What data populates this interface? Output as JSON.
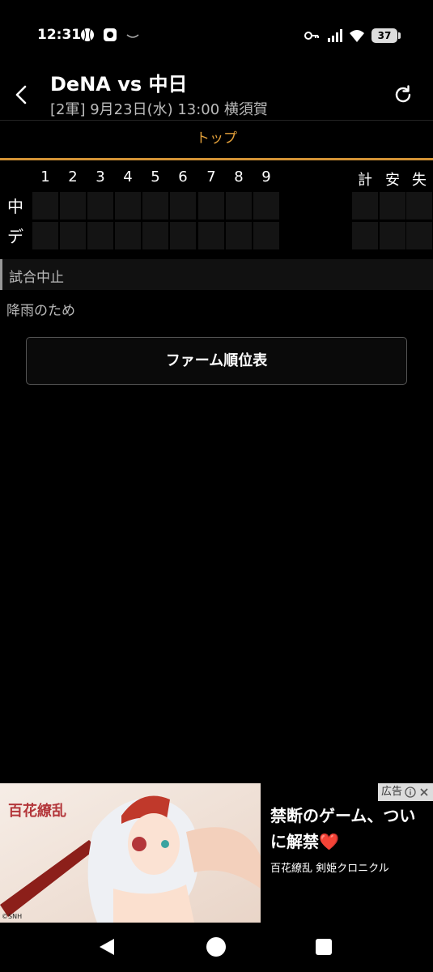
{
  "status_bar": {
    "time": "12:31",
    "battery": "37",
    "left_icons": [
      "baseball-icon",
      "app-icon",
      "notification-icon"
    ],
    "right_icons": [
      "key-icon",
      "signal-icon",
      "wifi-icon",
      "battery-icon"
    ]
  },
  "header": {
    "title": "DeNA vs 中日",
    "subtitle": "[2軍] 9月23日(水) 13:00 横須賀"
  },
  "tab": {
    "label": "トップ",
    "accent": "#d39335"
  },
  "scoreboard": {
    "innings": [
      "1",
      "2",
      "3",
      "4",
      "5",
      "6",
      "7",
      "8",
      "9"
    ],
    "totals": [
      "計",
      "安",
      "失"
    ],
    "teams": [
      "中",
      "デ"
    ]
  },
  "game_status": {
    "status": "試合中止",
    "reason": "降雨のため"
  },
  "farm_button": "ファーム順位表",
  "ad": {
    "badge": "広告",
    "headline_line1": "禁断のゲーム、つい",
    "headline_line2": "に解禁❤️",
    "source": "百花繚乱 剣姫クロニクル",
    "logo_text": "百花繚乱",
    "credit": "©SNH"
  }
}
